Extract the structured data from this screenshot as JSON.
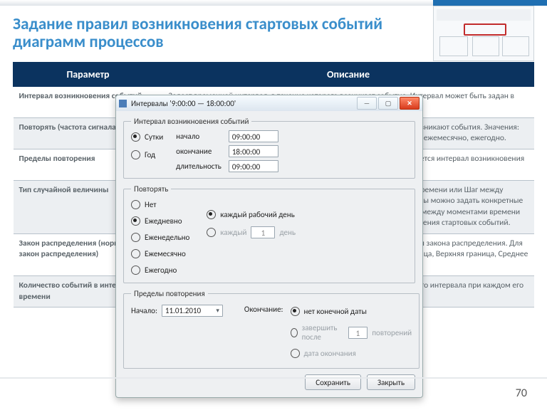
{
  "title": "Задание правил возникновения стартовых событий диаграмм процессов",
  "table": {
    "headers": {
      "param": "Параметр",
      "desc": "Описание"
    },
    "rows": [
      {
        "param": "Интервал возникновения событий",
        "desc": "Задает временной интервал, в течение которого возникает событие. Интервал может быть задан в пределах суток или года.",
        "band": false
      },
      {
        "param": "Повторять (частота сигнала)",
        "desc": "Задает частоту, с которой повторяется интервал, в пределах которого возникают события. Значения: не повторяется, повторяется каждую неделю, ежедневно, еженедельно, ежемесячно, ежегодно.",
        "band": true
      },
      {
        "param": "Пределы повторения",
        "desc": "Задаются даты начала и окончания периода, в рамках которого повторяется интервал возникновения событий.",
        "band": false
      },
      {
        "param": "Тип случайной величины",
        "desc": "Задает тип случайной величины. Тип может быть следующий: Момент времени или Шаг между моментами времени.\nМомент времени — в качестве случайной величины можно задать конкретные моменты времени, когда будет генерироваться стартовое событие.\nШаг между моментами времени — предоставляет возможность задать шаг между моментами возникновения стартовых событий.",
        "band": true
      },
      {
        "param": "Закон распределения (нормальный закон распределения)",
        "desc": "В зависимости от выбранного периода для каждого сигнала задается тип закона распределения.\nДля нормального закона распределения задаются параметры: Нижняя граница, Верхняя граница, Среднее и Стандартное отклонение.",
        "band": false
      },
      {
        "param": "Количество событий в интервале времени",
        "desc": "Задает количество событий, которое будет возникать в течение заданного интервала при каждом его повторении.",
        "band": true
      }
    ]
  },
  "dialog": {
    "title": "Интервалы '9:00:00 — 18:00:00'",
    "group_interval": {
      "legend": "Интервал возникновения событий",
      "opt_day": "Сутки",
      "opt_year": "Год",
      "lbl_start": "начало",
      "lbl_end": "окончание",
      "lbl_dur": "длительность",
      "val_start": "09:00:00",
      "val_end": "18:00:00",
      "val_dur": "09:00:00"
    },
    "group_repeat": {
      "legend": "Повторять",
      "opt_none": "Нет",
      "opt_daily": "Ежедневно",
      "opt_weekly": "Еженедельно",
      "opt_monthly": "Ежемесячно",
      "opt_yearly": "Ежегодно",
      "opt_workday": "каждый рабочий день",
      "opt_every": "каждый",
      "every_n": "1",
      "every_unit": "день"
    },
    "group_limits": {
      "legend": "Пределы повторения",
      "lbl_start": "Начало:",
      "start_date": "11.01.2010",
      "lbl_end": "Окончание:",
      "opt_noend": "нет конечной даты",
      "opt_after": "завершить после",
      "after_n": "1",
      "after_unit": "повторений",
      "opt_enddate": "дата окончания"
    },
    "btn_save": "Сохранить",
    "btn_close": "Закрыть"
  },
  "page_number": "70"
}
